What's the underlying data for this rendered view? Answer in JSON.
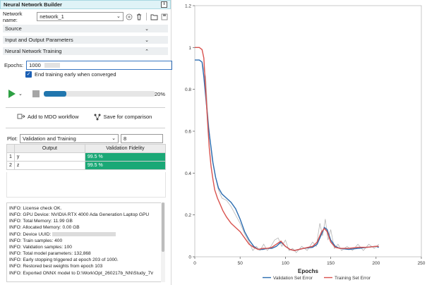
{
  "panel": {
    "title": "Neural Network Builder",
    "network_label": "Network name:",
    "network_value": "network_1",
    "sections": {
      "source": "Source",
      "io": "Input and Output Parameters",
      "training": "Neural Network Training"
    },
    "epochs_label": "Epochs:",
    "epochs_value": "1000",
    "early_stop_label": "End training early when converged",
    "progress": {
      "percent_label": "20%",
      "fraction": 0.2
    },
    "add_mdo": "Add to MDO workflow",
    "save_compare": "Save for comparison",
    "plot_label": "Plot:",
    "plot_value": "Validation and Training",
    "plot_number": "8",
    "table": {
      "headers": [
        "Output",
        "Validation Fidelity"
      ],
      "rows": [
        {
          "idx": "1",
          "output": "y",
          "fidelity": "99.5 %"
        },
        {
          "idx": "2",
          "output": "z",
          "fidelity": "99.5 %"
        }
      ]
    },
    "log": [
      "INFO: License check OK.",
      "INFO: GPU Device: NVIDIA RTX 4000 Ada Generation Laptop GPU",
      "INFO: Total Memory: 11.99 GB",
      "INFO: Allocated Memory: 0.00 GB",
      "INFO: Device UUID:",
      "INFO: Train samples: 400",
      "INFO: Validation samples: 100",
      "INFO: Total model parameters: 132,868",
      "INFO: Early stopping triggered at epoch 203 of 1000.",
      "INFO: Restored best weights from epoch 103",
      "INFO: Exported ONNX model to D:\\Work\\Opt_260217b_NN\\Study_7\\r"
    ]
  },
  "chart_data": {
    "type": "line",
    "xlabel": "Epochs",
    "ylabel": "",
    "xlim": [
      0,
      250
    ],
    "ylim": [
      0,
      1.2
    ],
    "xticks": [
      "0",
      "50",
      "100",
      "150",
      "200",
      "250"
    ],
    "yticks": [
      "0",
      "0.2",
      "0.4",
      "0.6",
      "0.8",
      "1",
      "1.2"
    ],
    "grid": false,
    "legend_position": "bottom-center",
    "series": [
      {
        "name": "Validation Set Error",
        "color": "#2b6cb0",
        "points": [
          [
            0,
            0.94
          ],
          [
            5,
            0.94
          ],
          [
            8,
            0.93
          ],
          [
            10,
            0.86
          ],
          [
            13,
            0.72
          ],
          [
            15,
            0.62
          ],
          [
            18,
            0.52
          ],
          [
            20,
            0.45
          ],
          [
            23,
            0.38
          ],
          [
            26,
            0.33
          ],
          [
            30,
            0.3
          ],
          [
            35,
            0.28
          ],
          [
            40,
            0.26
          ],
          [
            45,
            0.23
          ],
          [
            50,
            0.18
          ],
          [
            55,
            0.12
          ],
          [
            60,
            0.08
          ],
          [
            65,
            0.05
          ],
          [
            70,
            0.035
          ],
          [
            75,
            0.035
          ],
          [
            80,
            0.04
          ],
          [
            85,
            0.04
          ],
          [
            90,
            0.05
          ],
          [
            95,
            0.07
          ],
          [
            100,
            0.05
          ],
          [
            105,
            0.035
          ],
          [
            110,
            0.03
          ],
          [
            120,
            0.04
          ],
          [
            130,
            0.045
          ],
          [
            135,
            0.06
          ],
          [
            140,
            0.11
          ],
          [
            143,
            0.14
          ],
          [
            146,
            0.13
          ],
          [
            150,
            0.08
          ],
          [
            155,
            0.05
          ],
          [
            160,
            0.04
          ],
          [
            170,
            0.035
          ],
          [
            180,
            0.04
          ],
          [
            190,
            0.045
          ],
          [
            200,
            0.05
          ],
          [
            203,
            0.045
          ]
        ]
      },
      {
        "name": "Training Set Error",
        "color": "#d9534f",
        "points": [
          [
            0,
            1.0
          ],
          [
            5,
            1.0
          ],
          [
            8,
            0.99
          ],
          [
            10,
            0.95
          ],
          [
            12,
            0.8
          ],
          [
            14,
            0.65
          ],
          [
            16,
            0.52
          ],
          [
            18,
            0.43
          ],
          [
            20,
            0.37
          ],
          [
            22,
            0.32
          ],
          [
            25,
            0.28
          ],
          [
            28,
            0.25
          ],
          [
            31,
            0.22
          ],
          [
            35,
            0.19
          ],
          [
            40,
            0.16
          ],
          [
            45,
            0.14
          ],
          [
            50,
            0.12
          ],
          [
            55,
            0.09
          ],
          [
            60,
            0.06
          ],
          [
            65,
            0.045
          ],
          [
            70,
            0.035
          ],
          [
            75,
            0.04
          ],
          [
            80,
            0.04
          ],
          [
            85,
            0.045
          ],
          [
            90,
            0.06
          ],
          [
            95,
            0.075
          ],
          [
            100,
            0.05
          ],
          [
            105,
            0.035
          ],
          [
            110,
            0.03
          ],
          [
            120,
            0.04
          ],
          [
            130,
            0.05
          ],
          [
            135,
            0.07
          ],
          [
            140,
            0.12
          ],
          [
            143,
            0.135
          ],
          [
            146,
            0.12
          ],
          [
            150,
            0.07
          ],
          [
            155,
            0.045
          ],
          [
            160,
            0.04
          ],
          [
            170,
            0.04
          ],
          [
            180,
            0.045
          ],
          [
            190,
            0.045
          ],
          [
            200,
            0.05
          ],
          [
            203,
            0.05
          ]
        ]
      },
      {
        "name": "",
        "color": "#b5b5b5",
        "points": [
          [
            8,
            0.93
          ],
          [
            12,
            0.86
          ],
          [
            14,
            0.7
          ],
          [
            17,
            0.55
          ],
          [
            19,
            0.47
          ],
          [
            22,
            0.4
          ],
          [
            26,
            0.32
          ],
          [
            30,
            0.28
          ],
          [
            35,
            0.27
          ],
          [
            40,
            0.24
          ],
          [
            45,
            0.2
          ],
          [
            50,
            0.16
          ],
          [
            55,
            0.11
          ],
          [
            60,
            0.07
          ],
          [
            64,
            0.03
          ],
          [
            68,
            0.05
          ],
          [
            72,
            0.03
          ],
          [
            76,
            0.06
          ],
          [
            80,
            0.03
          ],
          [
            84,
            0.05
          ],
          [
            88,
            0.08
          ],
          [
            92,
            0.09
          ],
          [
            96,
            0.05
          ],
          [
            100,
            0.08
          ],
          [
            104,
            0.03
          ],
          [
            108,
            0.04
          ],
          [
            112,
            0.02
          ],
          [
            118,
            0.05
          ],
          [
            124,
            0.03
          ],
          [
            130,
            0.07
          ],
          [
            134,
            0.05
          ],
          [
            138,
            0.16
          ],
          [
            141,
            0.1
          ],
          [
            144,
            0.18
          ],
          [
            147,
            0.08
          ],
          [
            150,
            0.13
          ],
          [
            154,
            0.04
          ],
          [
            158,
            0.06
          ],
          [
            162,
            0.03
          ],
          [
            168,
            0.05
          ],
          [
            174,
            0.03
          ],
          [
            180,
            0.06
          ],
          [
            186,
            0.03
          ],
          [
            192,
            0.06
          ],
          [
            198,
            0.04
          ],
          [
            203,
            0.06
          ]
        ]
      }
    ]
  }
}
